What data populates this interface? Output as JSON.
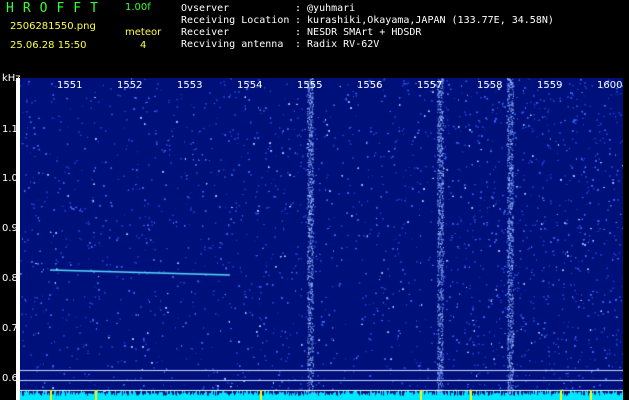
{
  "header": {
    "app_title": "HROFFT",
    "version": "1.00f",
    "filename": "2506281550.png",
    "datetime": "25.06.28 15:50",
    "meteor_label": "meteor",
    "meteor_count": "4"
  },
  "info": [
    {
      "label": "Ovserver",
      "value": ": @yuhmari"
    },
    {
      "label": "Receiving Location",
      "value": ": kurashiki,Okayama,JAPAN (133.77E, 34.58N)"
    },
    {
      "label": "Receiver",
      "value": ": NESDR SMArt + HDSDR"
    },
    {
      "label": "Recviving antenna",
      "value": ": Radix RV-62V"
    }
  ],
  "axes": {
    "y_unit": "kHz",
    "y_ticks": [
      "1.1",
      "1.0",
      "0.9",
      "0.8",
      "0.7",
      "0.6"
    ],
    "x_ticks": [
      "1551",
      "1552",
      "1553",
      "1554",
      "1555",
      "1556",
      "1557",
      "1558",
      "1559",
      "1600"
    ]
  },
  "colors": {
    "background": "#000000",
    "spectrogram_base": "#00107a",
    "noise": "#3a6cff",
    "meteor_trace": "#59d9ff",
    "baseline": "#00e8ff",
    "marker": "#ffff00"
  },
  "signals": {
    "meteor_echo": {
      "time_start": "15:50:00",
      "time_end": "15:53:00",
      "freq_khz_start": 0.82,
      "freq_khz_end": 0.81
    },
    "hline_freqs_khz": [
      0.62,
      0.6
    ],
    "vertical_bursts_at": [
      "15:54:20",
      "15:56:30",
      "15:57:40"
    ],
    "marker_times": [
      "15:50:00",
      "15:50:45",
      "15:53:30",
      "15:56:10",
      "15:57:00",
      "15:58:30",
      "15:59:00",
      "16:00:20"
    ]
  }
}
